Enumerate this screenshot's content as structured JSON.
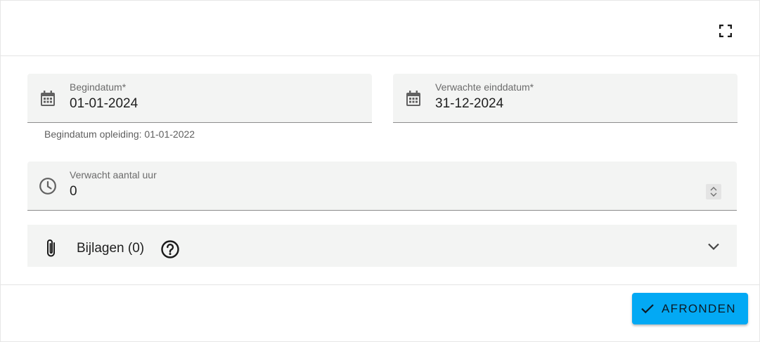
{
  "dialog": {
    "fullscreen_icon": "fullscreen-icon"
  },
  "start_date": {
    "label": "Begindatum*",
    "value": "01-01-2024",
    "icon": "calendar-icon",
    "hint": "Begindatum opleiding: 01-01-2022"
  },
  "end_date": {
    "label": "Verwachte einddatum*",
    "value": "31-12-2024",
    "icon": "calendar-icon"
  },
  "hours": {
    "label": "Verwacht aantal uur",
    "value": "0",
    "icon": "clock-icon",
    "stepper_icon": "unfold-icon"
  },
  "attachments": {
    "label": "Bijlagen (0)",
    "icon": "paperclip-icon",
    "help_icon": "help-circle-icon",
    "expand_icon": "chevron-down-icon"
  },
  "footer": {
    "finish_label": "AFRONDEN",
    "finish_icon": "check-icon"
  },
  "colors": {
    "accent": "#03a9f4",
    "field_bg": "#f3f4f3",
    "divider": "#e4e4e4"
  }
}
